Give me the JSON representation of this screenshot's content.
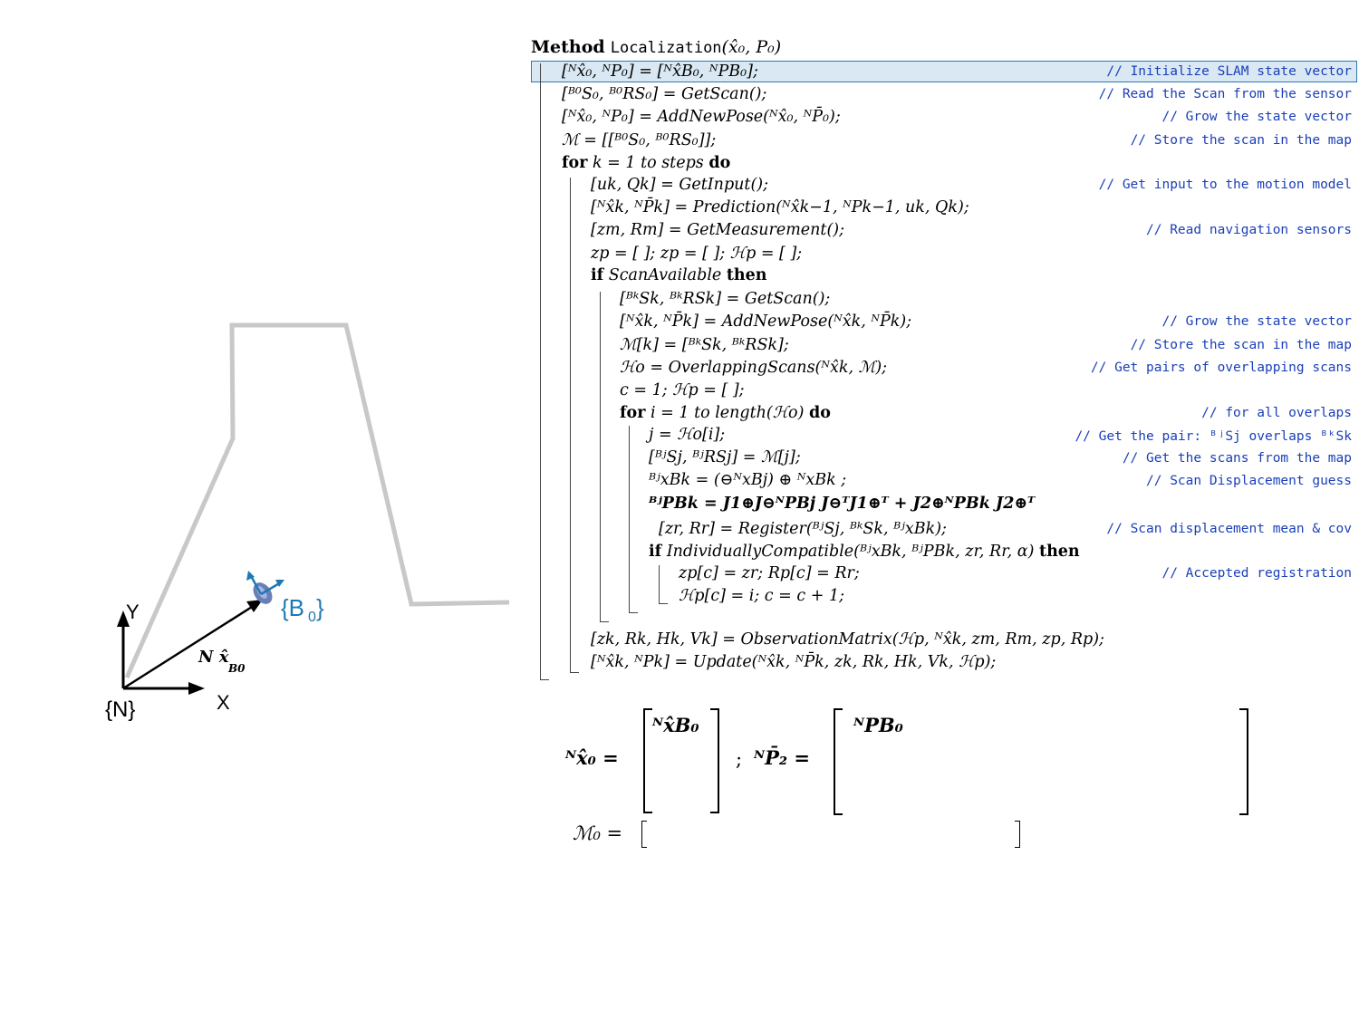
{
  "scene": {
    "axis_x_label": "X",
    "axis_y_label": "Y",
    "frame_n_label": "{N}",
    "frame_b0_label": "{B",
    "frame_b0_sub": "0",
    "frame_b0_close": "}",
    "pose_vector_label": "N x̂",
    "pose_vector_sub": "B0",
    "colors": {
      "wall": "#c8c8c8",
      "robot": "#1f78b4",
      "axes": "#000000"
    }
  },
  "algorithm": {
    "keyword_method": "Method",
    "method_name": "Localization",
    "method_args": "(x̂₀, P₀)",
    "lines": [
      {
        "code": "[ᴺx̂₀, ᴺP₀] = [ᴺx̂B₀, ᴺPB₀];",
        "comment": "// Initialize SLAM state vector"
      },
      {
        "code": "[ᴮ⁰S₀, ᴮ⁰RS₀] = GetScan();",
        "comment": "// Read the Scan from the sensor"
      },
      {
        "code": "[ᴺx̂₀, ᴺP₀] = AddNewPose(ᴺx̂₀, ᴺP̄₀);",
        "comment": "// Grow the state vector"
      },
      {
        "code": "ℳ = [[ᴮ⁰S₀, ᴮ⁰RS₀]];",
        "comment": "// Store the scan in the map"
      },
      {
        "kw1": "for",
        "code": " k = 1 to steps ",
        "kw2": "do",
        "comment": ""
      },
      {
        "code": "[uk, Qk] = GetInput();",
        "comment": "// Get input to the motion model"
      },
      {
        "code": "[ᴺx̂k, ᴺP̄k] = Prediction(ᴺx̂k−1, ᴺPk−1, uk, Qk);",
        "comment": ""
      },
      {
        "code": "[zm, Rm] = GetMeasurement();",
        "comment": "// Read navigation sensors"
      },
      {
        "code": "zp = [ ]; zp = [ ]; ℋp = [ ];",
        "comment": ""
      },
      {
        "kw1": "if",
        "code": " ScanAvailable ",
        "kw2": "then",
        "comment": ""
      },
      {
        "code": "[ᴮᵏSk, ᴮᵏRSk] = GetScan();",
        "comment": ""
      },
      {
        "code": "[ᴺx̂k, ᴺP̄k] = AddNewPose(ᴺx̂k, ᴺP̄k);",
        "comment": "// Grow the state vector"
      },
      {
        "code": "ℳ[k] = [ᴮᵏSk, ᴮᵏRSk];",
        "comment": "// Store the scan in the map"
      },
      {
        "code": "ℋo = OverlappingScans(ᴺx̂k, ℳ);",
        "comment": "// Get pairs of overlapping scans"
      },
      {
        "code": "c = 1; ℋp = [ ];",
        "comment": ""
      },
      {
        "kw1": "for",
        "code": " i = 1 to length(ℋo) ",
        "kw2": "do",
        "comment": "// for all overlaps"
      },
      {
        "code": "j = ℋo[i];",
        "comment": "// Get the pair:  ᴮʲSj overlaps ᴮᵏSk"
      },
      {
        "code": "[ᴮʲSj, ᴮʲRSj] = ℳ[j];",
        "comment": "// Get the scans from the map"
      },
      {
        "code": "ᴮʲxBk = (⊖ᴺxBj) ⊕ ᴺxBk ;",
        "comment": "// Scan Displacement guess"
      },
      {
        "code": "ᴮʲPBk = J1⊕J⊖ᴺPBj J⊖ᵀJ1⊕ᵀ + J2⊕ᴺPBk J2⊕ᵀ",
        "comment": ""
      },
      {
        "code": "[zr, Rr] = Register(ᴮʲSj, ᴮᵏSk, ᴮʲxBk);",
        "comment": "// Scan displacement mean & cov"
      },
      {
        "kw1": "if",
        "code": " IndividuallyCompatible(ᴮʲxBk, ᴮʲPBk, zr, Rr, α) ",
        "kw2": "then",
        "comment": ""
      },
      {
        "code": "zp[c] = zr;  Rp[c] = Rr;",
        "comment": "// Accepted registration"
      },
      {
        "code": "ℋp[c] = i; c = c + 1;",
        "comment": ""
      },
      {
        "code": "[zk, Rk, Hk, Vk] = ObservationMatrix(ℋp, ᴺx̂k, zm, Rm, zp, Rp);",
        "comment": ""
      },
      {
        "code": "[ᴺx̂k, ᴺPk] = Update(ᴺx̂k, ᴺP̄k, zk, Rk, Hk, Vk, ℋp);",
        "comment": ""
      }
    ]
  },
  "matrices": {
    "x0_lhs": "ᴺx̂₀ =",
    "x0_entry": "ᴺx̂B₀",
    "separator": ";",
    "p2_lhs": "ᴺP̄₂ =",
    "p2_entry": "ᴺPB₀",
    "m0_lhs": "ℳ₀ ="
  }
}
